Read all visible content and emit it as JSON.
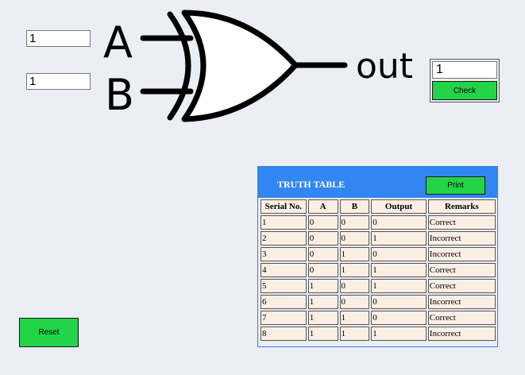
{
  "inputs": {
    "a_value": "1",
    "b_value": "1"
  },
  "gate": {
    "label_a": "A",
    "label_b": "B",
    "label_out": "out"
  },
  "output": {
    "value": "1",
    "check_label": "Check"
  },
  "reset_label": "Reset",
  "truth_table": {
    "title": "TRUTH TABLE",
    "print_label": "Print",
    "headers": [
      "Serial No.",
      "A",
      "B",
      "Output",
      "Remarks"
    ],
    "rows": [
      [
        "1",
        "0",
        "0",
        "0",
        "Correct"
      ],
      [
        "2",
        "0",
        "0",
        "1",
        "Incorrect"
      ],
      [
        "3",
        "0",
        "1",
        "0",
        "Incorrect"
      ],
      [
        "4",
        "0",
        "1",
        "1",
        "Correct"
      ],
      [
        "5",
        "1",
        "0",
        "1",
        "Correct"
      ],
      [
        "6",
        "1",
        "0",
        "0",
        "Incorrect"
      ],
      [
        "7",
        "1",
        "1",
        "0",
        "Correct"
      ],
      [
        "8",
        "1",
        "1",
        "1",
        "Incorrect"
      ]
    ]
  },
  "colors": {
    "button_green": "#22d448",
    "table_header_blue": "#3186f1",
    "cell_bg": "#fbeee3",
    "page_bg": "#ebeef4"
  }
}
